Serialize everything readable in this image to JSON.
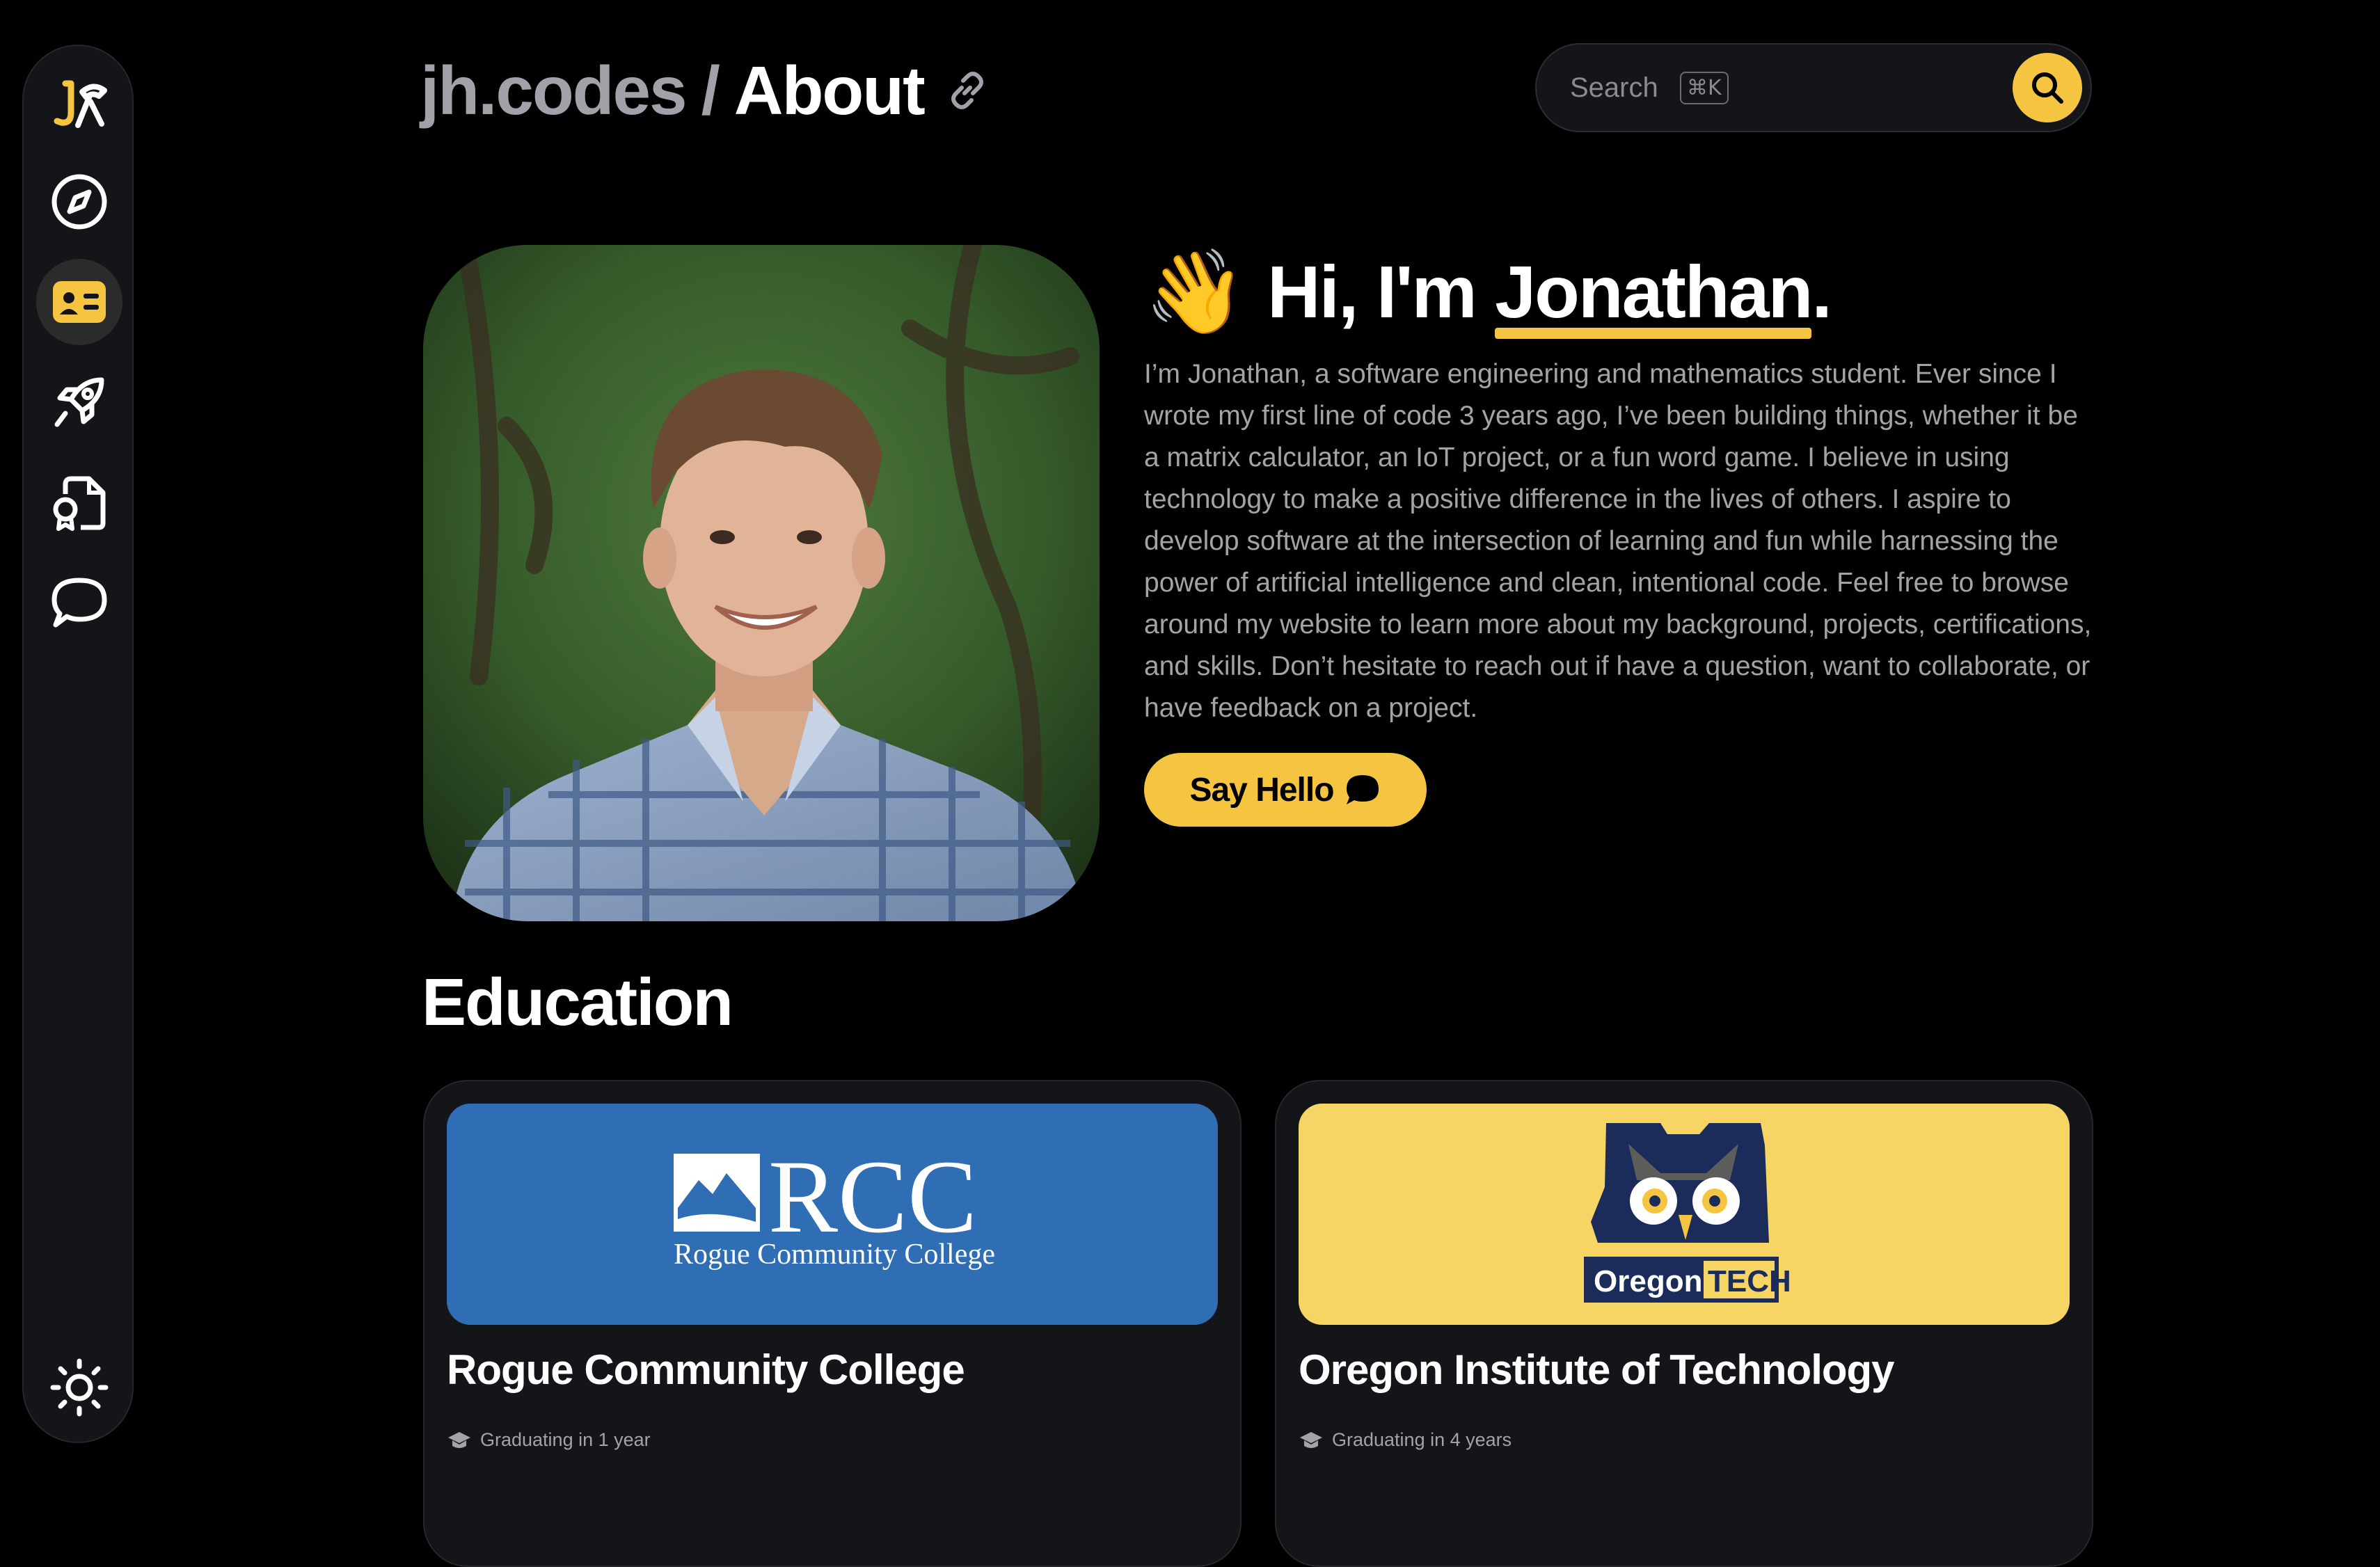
{
  "header": {
    "site": "jh.codes",
    "separator": "/",
    "page": "About"
  },
  "search": {
    "placeholder": "Search",
    "shortcut": "⌘K"
  },
  "sidebar": {
    "items": [
      {
        "name": "home-logo",
        "icon": "jh-logo"
      },
      {
        "name": "explore",
        "icon": "compass-icon"
      },
      {
        "name": "about",
        "icon": "id-card-icon",
        "active": true
      },
      {
        "name": "projects",
        "icon": "rocket-icon"
      },
      {
        "name": "certifications",
        "icon": "certificate-file-icon"
      },
      {
        "name": "contact",
        "icon": "chat-bubble-icon"
      }
    ],
    "theme_toggle": {
      "icon": "sun-icon"
    }
  },
  "hero": {
    "wave": "👋",
    "greeting_prefix": "Hi, I'm ",
    "name": "Jonathan",
    "greeting_suffix": ".",
    "bio": "I’m Jonathan, a software engineering and mathematics student. Ever since I wrote my first line of code 3 years ago, I’ve been building things, whether it be a matrix calculator, an IoT project, or a fun word game. I believe in using technology to make a positive difference in the lives of others. I aspire to develop software at the intersection of learning and fun while harnessing the power of artificial intelligence and clean, intentional code. Feel free to browse around my website to learn more about my background, projects, certifications, and skills. Don’t hesitate to reach out if have a question, want to collaborate, or have feedback on a project.",
    "cta_label": "Say Hello"
  },
  "education": {
    "title": "Education",
    "schools": [
      {
        "name": "Rogue Community College",
        "logo_text": "RCC",
        "logo_subtext": "Rogue Community College",
        "status": "Graduating in 1 year",
        "banner_color": "#2f6db5"
      },
      {
        "name": "Oregon Institute of Technology",
        "logo_word1": "Oregon",
        "logo_word2": "TECH",
        "status": "Graduating in 4 years",
        "banner_color": "#f7d565"
      }
    ]
  },
  "colors": {
    "accent": "#f5c542",
    "background": "#000000",
    "panel": "#141518",
    "muted_text": "#a3a3a8"
  }
}
